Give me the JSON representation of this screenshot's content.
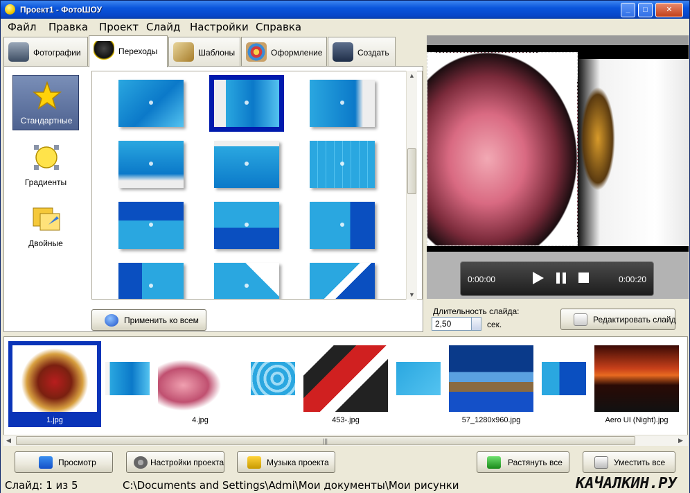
{
  "window": {
    "title": "Проект1 - ФотоШОУ",
    "min_label": "_",
    "max_label": "□",
    "close_label": "✕"
  },
  "menu": [
    "Файл",
    "Правка",
    "Проект",
    "Слайд",
    "Настройки",
    "Справка"
  ],
  "tabs": [
    {
      "label": "Фотографии",
      "icon": "camera-icon"
    },
    {
      "label": "Переходы",
      "icon": "magic-hat-icon",
      "active": true
    },
    {
      "label": "Шаблоны",
      "icon": "template-icon"
    },
    {
      "label": "Оформление",
      "icon": "palette-icon"
    },
    {
      "label": "Создать",
      "icon": "video-camera-icon"
    }
  ],
  "categories": [
    {
      "label": "Стандартные",
      "icon": "star-icon",
      "active": true
    },
    {
      "label": "Градиенты",
      "icon": "gradient-icon"
    },
    {
      "label": "Двойные",
      "icon": "double-icon"
    }
  ],
  "apply_all": "Применить ко всем",
  "player": {
    "time_start": "0:00:00",
    "time_end": "0:00:20"
  },
  "duration": {
    "label": "Длительность слайда:",
    "value": "2,50",
    "unit": "сек."
  },
  "edit_slide": "Редактировать слайд",
  "slides": [
    {
      "label": "1.jpg",
      "active": true
    },
    {
      "label": "4.jpg"
    },
    {
      "label": "453-.jpg"
    },
    {
      "label": "57_1280x960.jpg"
    },
    {
      "label": "Aero UI (Night).jpg"
    }
  ],
  "bottom_buttons": [
    "Просмотр",
    "Настройки проекта",
    "Музыка проекта",
    "Растянуть все",
    "Уместить все"
  ],
  "status": {
    "slide": "Слайд: 1 из 5",
    "path": "C:\\Documents and Settings\\Admi\\Мои документы\\Мои рисунки"
  },
  "watermark": "КАЧАЛКИН.РУ",
  "colors": {
    "selection": "#001aad",
    "thumb_blue": "#0b79c9",
    "titlebar": "#0a55dc"
  }
}
